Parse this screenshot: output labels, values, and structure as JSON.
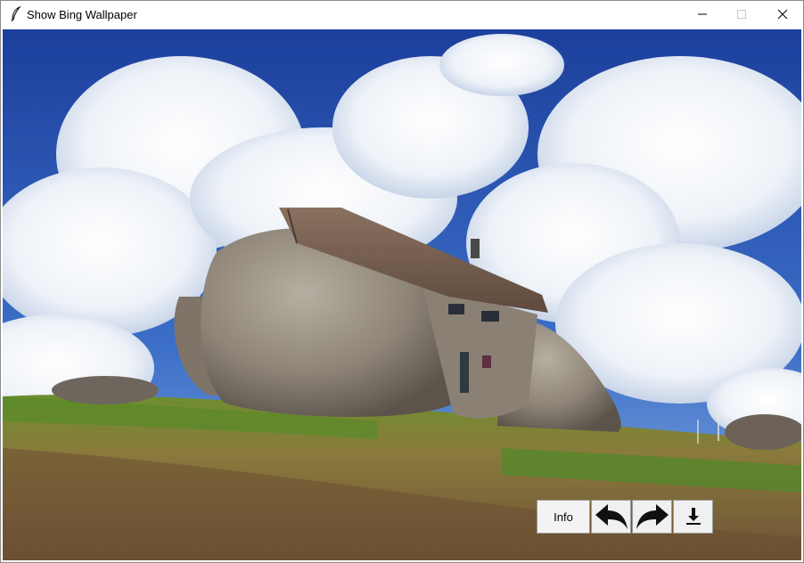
{
  "window": {
    "title": "Show Bing Wallpaper",
    "icons": {
      "app": "feather-icon",
      "minimize": "minimize-icon",
      "maximize": "maximize-icon",
      "close": "close-icon"
    }
  },
  "wallpaper": {
    "subject": "stone-house-on-boulders-photo"
  },
  "toolbar": {
    "info_label": "Info",
    "icons": [
      "previous-arrow-icon",
      "next-arrow-icon",
      "download-icon"
    ]
  }
}
